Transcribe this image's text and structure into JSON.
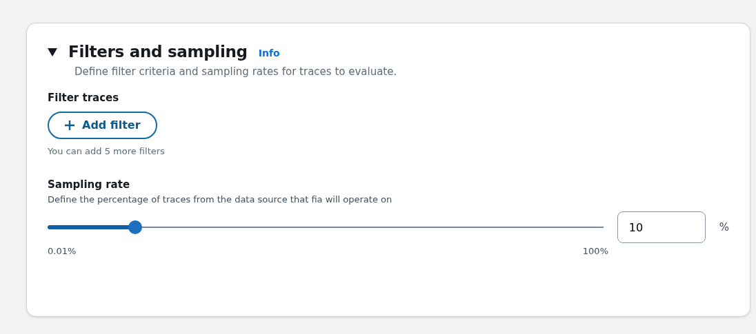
{
  "section": {
    "title": "Filters and sampling",
    "expanded": true,
    "info_link": "Info",
    "description": "Define filter criteria and sampling rates for traces to evaluate."
  },
  "filter_traces": {
    "label": "Filter traces",
    "button": "Add filter",
    "hint": "You can add 5 more filters"
  },
  "sampling_rate": {
    "label": "Sampling rate",
    "description": "Define the percentage of traces from the data source that fia will operate on",
    "level": 0.157,
    "min_label": "0.01%",
    "max_label": "100%",
    "value": "10",
    "unit": "%"
  }
}
